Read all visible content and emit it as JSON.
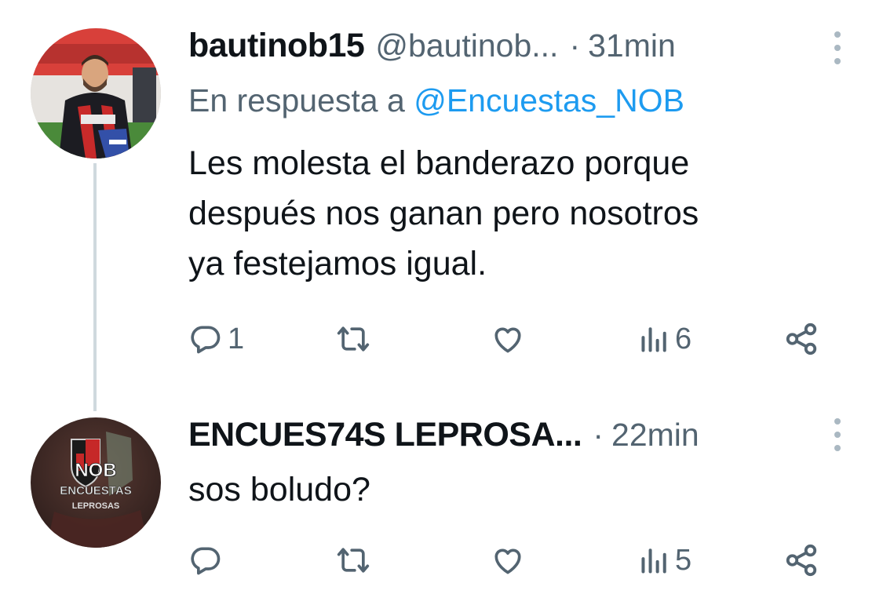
{
  "tweets": [
    {
      "name": "bautinob15",
      "handle": "@bautinob...",
      "separator": "·",
      "time": "31min",
      "reply_prefix": "En respuesta a",
      "reply_mention": "@Encuestas_NOB",
      "text_lines": [
        "Les molesta el banderazo porque",
        "después nos ganan pero nosotros",
        "ya festejamos igual."
      ],
      "replies": "1",
      "views": "6",
      "avatar": "player-photo"
    },
    {
      "name": "ENCUES74S LEPROSA...",
      "separator": "·",
      "time": "22min",
      "text_lines": [
        "sos boludo?"
      ],
      "replies": "",
      "views": "5",
      "avatar_text": {
        "line1": "NOB",
        "line2": "ENCUESTAS",
        "line3": "LEPROSAS"
      }
    }
  ],
  "icons": [
    "reply-icon",
    "retweet-icon",
    "like-icon",
    "views-icon",
    "share-icon",
    "more-icon"
  ],
  "colors": {
    "text": "#0f1419",
    "secondary": "#536471",
    "link": "#1d9bf0",
    "thread_line": "#cfd9de"
  }
}
